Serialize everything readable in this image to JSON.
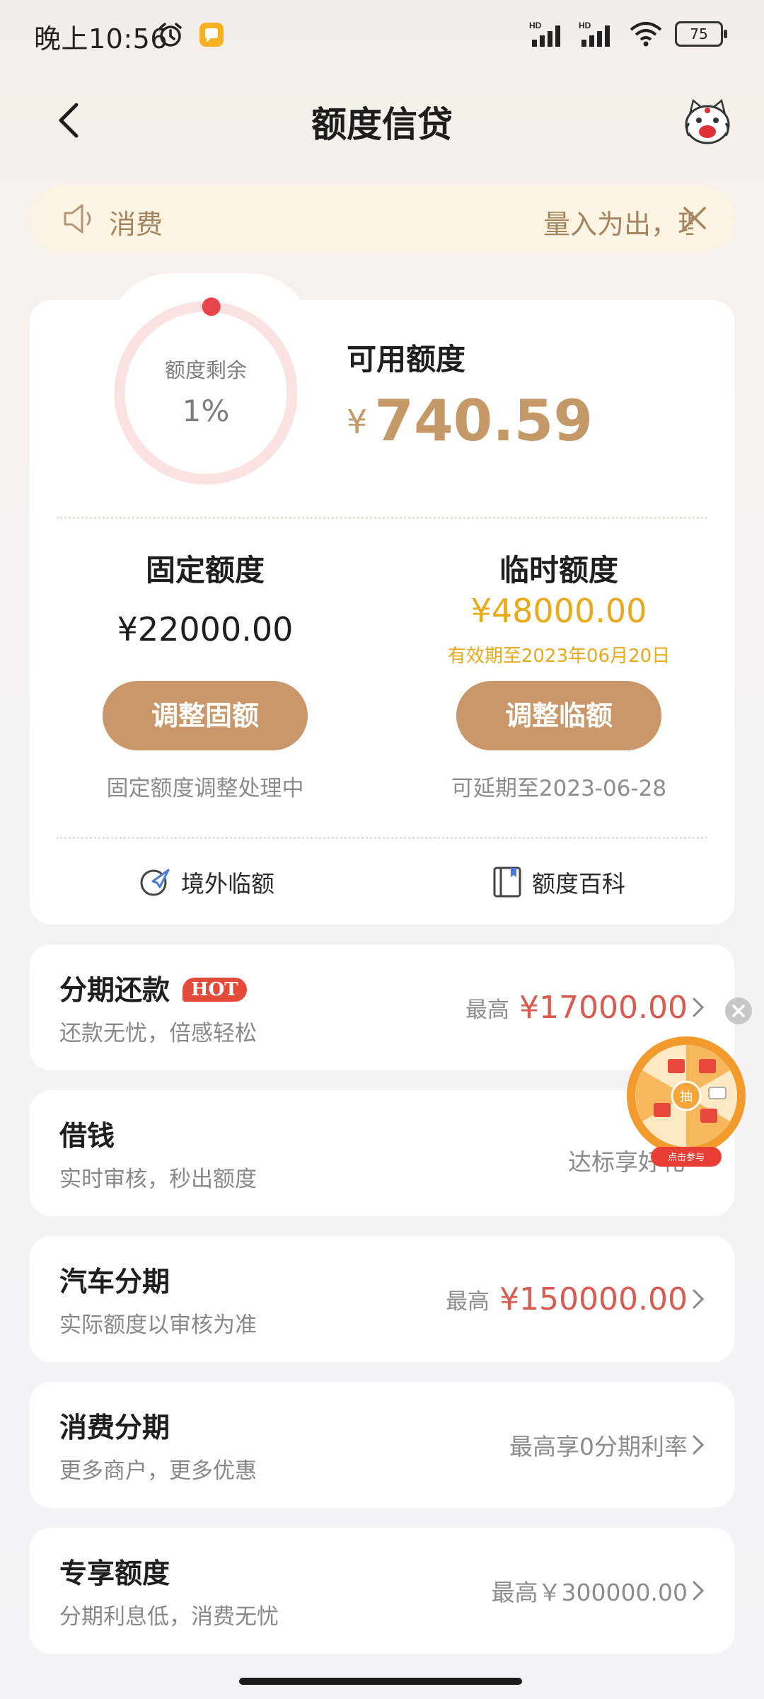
{
  "status_bar": {
    "time": "晚上10:56",
    "battery": "75"
  },
  "header": {
    "title": "额度信贷"
  },
  "notice": {
    "label": "消费",
    "scroll_text": "量入为出，理性消费"
  },
  "credit": {
    "ring_label": "额度剩余",
    "ring_percent": "1%",
    "ring_fraction": 0.01,
    "available_label": "可用额度",
    "currency_symbol": "¥",
    "available_amount": "740.59",
    "fixed": {
      "title": "固定额度",
      "amount": "¥22000.00",
      "button": "调整固额",
      "status": "固定额度调整处理中"
    },
    "temporary": {
      "title": "临时额度",
      "amount": "¥48000.00",
      "valid": "有效期至2023年06月20日",
      "button": "调整临额",
      "status": "可延期至2023-06-28"
    },
    "links": [
      {
        "label": "境外临额",
        "icon": "globe-plane-icon"
      },
      {
        "label": "额度百科",
        "icon": "book-icon"
      }
    ]
  },
  "services": [
    {
      "title": "分期还款",
      "badge": "HOT",
      "subtitle": "还款无忧，倍感轻松",
      "prefix": "最高",
      "amount": "¥17000.00"
    },
    {
      "title": "借钱",
      "subtitle": "实时审核，秒出额度",
      "right_text": "达标享好礼"
    },
    {
      "title": "汽车分期",
      "subtitle": "实际额度以审核为准",
      "prefix": "最高",
      "amount": "¥150000.00"
    },
    {
      "title": "消费分期",
      "subtitle": "更多商户，更多优惠",
      "right_text": "最高享0分期利率"
    },
    {
      "title": "专享额度",
      "subtitle": "分期利息低，消费无忧",
      "right_text": "最高￥300000.00"
    }
  ],
  "floating_wheel": {
    "center_label": "抽",
    "cta": "点击参与"
  },
  "colors": {
    "accent_gold": "#c9976a",
    "temp_yellow": "#e9a91c",
    "amount_red": "#d95a50",
    "ring_track": "#fbe2e2",
    "ring_dot": "#e8454a"
  }
}
